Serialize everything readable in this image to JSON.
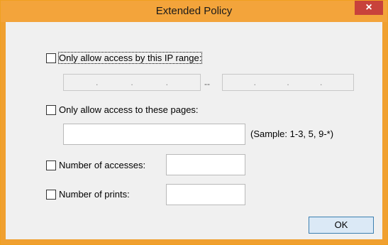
{
  "window": {
    "title": "Extended Policy",
    "close_glyph": "×"
  },
  "ip_range": {
    "checked": false,
    "label": "Only allow access by this IP range:",
    "separator": "--",
    "start_dots": ".",
    "end_dots": "."
  },
  "pages": {
    "checked": false,
    "label": "Only allow access to these pages:",
    "value": "",
    "sample": "(Sample: 1-3, 5, 9-*)"
  },
  "accesses": {
    "checked": false,
    "label": "Number of accesses:",
    "value": ""
  },
  "prints": {
    "checked": false,
    "label": "Number of prints:",
    "value": ""
  },
  "buttons": {
    "ok_label": "OK"
  }
}
